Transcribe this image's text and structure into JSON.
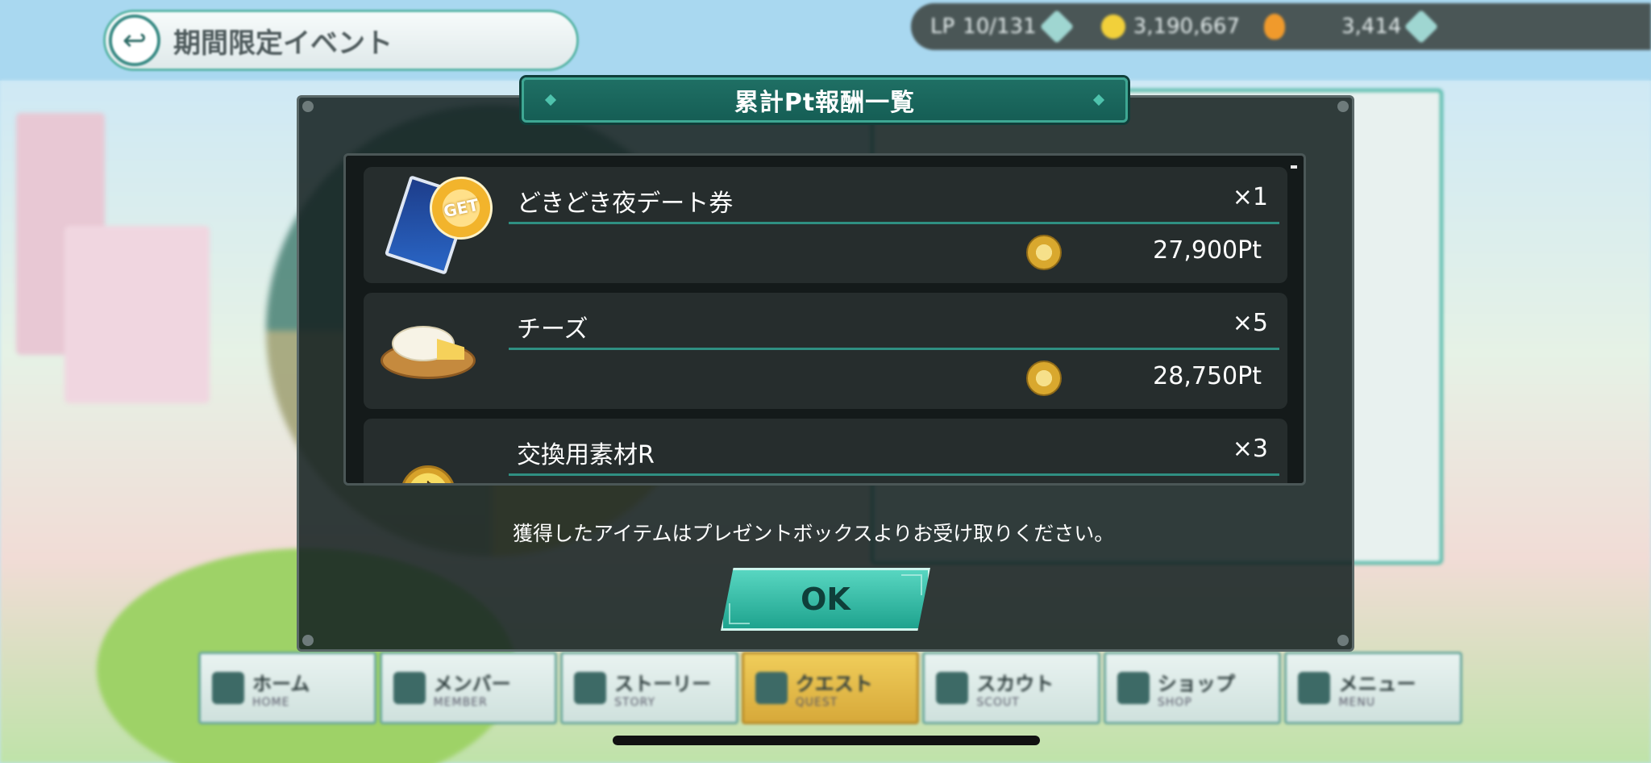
{
  "top_bar": {
    "title": "期間限定イベント",
    "status": [
      {
        "label": "LP",
        "value": "10/131"
      },
      {
        "value": "3,190,667"
      },
      {
        "value": "3,414"
      }
    ]
  },
  "modal": {
    "title": "累計Pt報酬一覧",
    "items": [
      {
        "name": "どきどき夜デート券",
        "qty": "×1",
        "points": "27,900Pt",
        "badge": "GET"
      },
      {
        "name": "チーズ",
        "qty": "×5",
        "points": "28,750Pt"
      },
      {
        "name": "交換用素材R",
        "qty": "×3",
        "icon": "♪"
      }
    ],
    "notice": "獲得したアイテムはプレゼントボックスよりお受け取りください。",
    "ok_label": "OK"
  },
  "bottom_nav": [
    {
      "label": "ホーム",
      "sub": "HOME"
    },
    {
      "label": "メンバー",
      "sub": "MEMBER"
    },
    {
      "label": "ストーリー",
      "sub": "STORY"
    },
    {
      "label": "クエスト",
      "sub": "QUEST"
    },
    {
      "label": "スカウト",
      "sub": "SCOUT"
    },
    {
      "label": "ショップ",
      "sub": "SHOP"
    },
    {
      "label": "メニュー",
      "sub": "MENU"
    }
  ],
  "colors": {
    "modal_bg": "#162222",
    "header_teal": "#1f6f64",
    "accent_line": "#2f8f82",
    "ok_button": "#1ea38e",
    "coin_gold": "#d9a82e"
  }
}
